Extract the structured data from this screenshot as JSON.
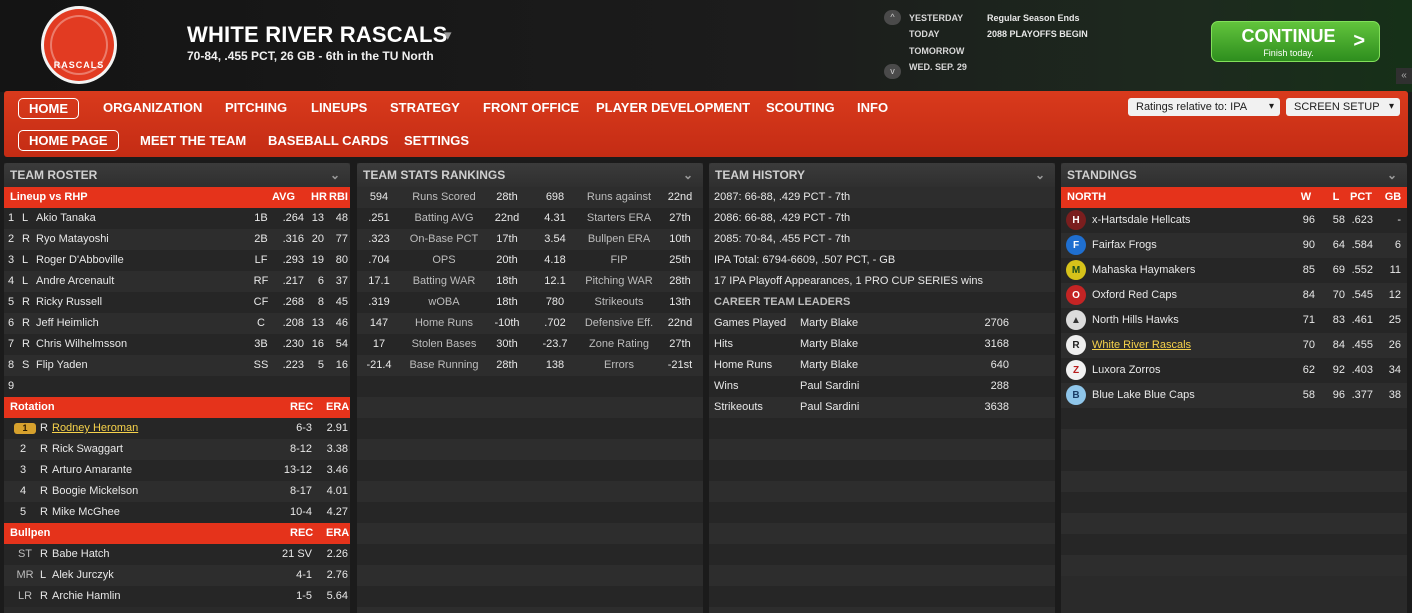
{
  "header": {
    "logo_text": "RASCALS",
    "team_name": "WHITE RIVER RASCALS",
    "record_line": "70-84, .455 PCT, 26 GB - 6th in the TU North",
    "dates": [
      "YESTERDAY",
      "TODAY",
      "TOMORROW",
      "WED. SEP. 29"
    ],
    "events": [
      "Regular Season Ends",
      "2088 PLAYOFFS BEGIN"
    ],
    "continue_label": "CONTINUE",
    "continue_sub": "Finish today.",
    "continue_arrow": ">",
    "up_arrow": "^",
    "down_arrow": "v",
    "collapse_glyph": "«"
  },
  "nav": {
    "top": [
      "HOME",
      "ORGANIZATION",
      "PITCHING",
      "LINEUPS",
      "STRATEGY",
      "FRONT OFFICE",
      "PLAYER DEVELOPMENT",
      "SCOUTING",
      "INFO"
    ],
    "sub": [
      "HOME PAGE",
      "MEET THE TEAM",
      "BASEBALL CARDS",
      "SETTINGS"
    ],
    "ratings_select": "Ratings relative to: IPA",
    "screen_setup": "SCREEN SETUP"
  },
  "roster": {
    "title": "TEAM ROSTER",
    "lineup_header": {
      "label": "Lineup vs RHP",
      "avg": "AVG",
      "hr": "HR",
      "rbi": "RBI"
    },
    "lineup": [
      {
        "n": "1",
        "hand": "L",
        "name": "Akio Tanaka",
        "pos": "1B",
        "avg": ".264",
        "hr": "13",
        "rbi": "48"
      },
      {
        "n": "2",
        "hand": "R",
        "name": "Ryo Matayoshi",
        "pos": "2B",
        "avg": ".316",
        "hr": "20",
        "rbi": "77"
      },
      {
        "n": "3",
        "hand": "L",
        "name": "Roger D'Abboville",
        "pos": "LF",
        "avg": ".293",
        "hr": "19",
        "rbi": "80"
      },
      {
        "n": "4",
        "hand": "L",
        "name": "Andre Arcenault",
        "pos": "RF",
        "avg": ".217",
        "hr": "6",
        "rbi": "37"
      },
      {
        "n": "5",
        "hand": "R",
        "name": "Ricky Russell",
        "pos": "CF",
        "avg": ".268",
        "hr": "8",
        "rbi": "45"
      },
      {
        "n": "6",
        "hand": "R",
        "name": "Jeff Heimlich",
        "pos": "C",
        "avg": ".208",
        "hr": "13",
        "rbi": "46"
      },
      {
        "n": "7",
        "hand": "R",
        "name": "Chris Wilhelmsson",
        "pos": "3B",
        "avg": ".230",
        "hr": "16",
        "rbi": "54"
      },
      {
        "n": "8",
        "hand": "S",
        "name": "Flip Yaden",
        "pos": "SS",
        "avg": ".223",
        "hr": "5",
        "rbi": "16"
      },
      {
        "n": "9",
        "hand": "",
        "name": "",
        "pos": "",
        "avg": "",
        "hr": "",
        "rbi": ""
      }
    ],
    "rotation_header": {
      "label": "Rotation",
      "rec": "REC",
      "era": "ERA"
    },
    "rotation": [
      {
        "n": "1",
        "hand": "R",
        "name": "Rodney Heroman",
        "rec": "6-3",
        "era": "2.91"
      },
      {
        "n": "2",
        "hand": "R",
        "name": "Rick Swaggart",
        "rec": "8-12",
        "era": "3.38"
      },
      {
        "n": "3",
        "hand": "R",
        "name": "Arturo Amarante",
        "rec": "13-12",
        "era": "3.46"
      },
      {
        "n": "4",
        "hand": "R",
        "name": "Boogie Mickelson",
        "rec": "8-17",
        "era": "4.01"
      },
      {
        "n": "5",
        "hand": "R",
        "name": "Mike McGhee",
        "rec": "10-4",
        "era": "4.27"
      }
    ],
    "bullpen_header": {
      "label": "Bullpen",
      "rec": "REC",
      "era": "ERA"
    },
    "bullpen": [
      {
        "role": "ST",
        "hand": "R",
        "name": "Babe Hatch",
        "rec": "21 SV",
        "era": "2.26"
      },
      {
        "role": "MR",
        "hand": "L",
        "name": "Alek Jurczyk",
        "rec": "4-1",
        "era": "2.76"
      },
      {
        "role": "LR",
        "hand": "R",
        "name": "Archie Hamlin",
        "rec": "1-5",
        "era": "5.64"
      }
    ]
  },
  "rankings": {
    "title": "TEAM STATS RANKINGS",
    "rows": [
      {
        "v1": "594",
        "l1": "Runs Scored",
        "r1": "28th",
        "v2": "698",
        "l2": "Runs against",
        "r2": "22nd"
      },
      {
        "v1": ".251",
        "l1": "Batting AVG",
        "r1": "22nd",
        "v2": "4.31",
        "l2": "Starters ERA",
        "r2": "27th"
      },
      {
        "v1": ".323",
        "l1": "On-Base PCT",
        "r1": "17th",
        "v2": "3.54",
        "l2": "Bullpen ERA",
        "r2": "10th"
      },
      {
        "v1": ".704",
        "l1": "OPS",
        "r1": "20th",
        "v2": "4.18",
        "l2": "FIP",
        "r2": "25th"
      },
      {
        "v1": "17.1",
        "l1": "Batting WAR",
        "r1": "18th",
        "v2": "12.1",
        "l2": "Pitching WAR",
        "r2": "28th"
      },
      {
        "v1": ".319",
        "l1": "wOBA",
        "r1": "18th",
        "v2": "780",
        "l2": "Strikeouts",
        "r2": "13th"
      },
      {
        "v1": "147",
        "l1": "Home Runs",
        "r1": "-10th",
        "v2": ".702",
        "l2": "Defensive Eff.",
        "r2": "22nd"
      },
      {
        "v1": "17",
        "l1": "Stolen Bases",
        "r1": "30th",
        "v2": "-23.7",
        "l2": "Zone Rating",
        "r2": "27th"
      },
      {
        "v1": "-21.4",
        "l1": "Base Running",
        "r1": "28th",
        "v2": "138",
        "l2": "Errors",
        "r2": "-21st"
      }
    ]
  },
  "history": {
    "title": "TEAM HISTORY",
    "lines": [
      "2087: 66-88, .429 PCT - 7th",
      "2086: 66-88, .429 PCT - 7th",
      "2085: 70-84, .455 PCT - 7th",
      "IPA Total: 6794-6609, .507 PCT, - GB",
      "17 IPA Playoff Appearances, 1 PRO CUP SERIES wins"
    ],
    "leaders_title": "CAREER TEAM LEADERS",
    "leaders": [
      {
        "cat": "Games Played",
        "name": "Marty Blake",
        "val": "2706"
      },
      {
        "cat": "Hits",
        "name": "Marty Blake",
        "val": "3168"
      },
      {
        "cat": "Home Runs",
        "name": "Marty Blake",
        "val": "640"
      },
      {
        "cat": "Wins",
        "name": "Paul Sardini",
        "val": "288"
      },
      {
        "cat": "Strikeouts",
        "name": "Paul Sardini",
        "val": "3638"
      }
    ]
  },
  "standings": {
    "title": "STANDINGS",
    "header": {
      "div": "NORTH",
      "w": "W",
      "l": "L",
      "pct": "PCT",
      "gb": "GB"
    },
    "teams": [
      {
        "name": "x-Hartsdale Hellcats",
        "w": "96",
        "l": "58",
        "pct": ".623",
        "gb": "-",
        "icon": "hellcats-logo-icon",
        "bg": "#7a1e1e",
        "fg": "#ffffff",
        "glyph": "H"
      },
      {
        "name": "Fairfax Frogs",
        "w": "90",
        "l": "64",
        "pct": ".584",
        "gb": "6",
        "icon": "frogs-logo-icon",
        "bg": "#1f6fd0",
        "fg": "#ffffff",
        "glyph": "F"
      },
      {
        "name": "Mahaska Haymakers",
        "w": "85",
        "l": "69",
        "pct": ".552",
        "gb": "11",
        "icon": "haymakers-logo-icon",
        "bg": "#d6c21a",
        "fg": "#1b4d1b",
        "glyph": "M"
      },
      {
        "name": "Oxford Red Caps",
        "w": "84",
        "l": "70",
        "pct": ".545",
        "gb": "12",
        "icon": "redcaps-logo-icon",
        "bg": "#c42424",
        "fg": "#ffffff",
        "glyph": "O"
      },
      {
        "name": "North Hills Hawks",
        "w": "71",
        "l": "83",
        "pct": ".461",
        "gb": "25",
        "icon": "hawks-logo-icon",
        "bg": "#dcdcdc",
        "fg": "#333333",
        "glyph": "▲"
      },
      {
        "name": "White River Rascals",
        "w": "70",
        "l": "84",
        "pct": ".455",
        "gb": "26",
        "icon": "rascals-logo-icon",
        "bg": "#eeeeee",
        "fg": "#222222",
        "glyph": "R"
      },
      {
        "name": "Luxora Zorros",
        "w": "62",
        "l": "92",
        "pct": ".403",
        "gb": "34",
        "icon": "zorros-logo-icon",
        "bg": "#f2f2f2",
        "fg": "#b81c1c",
        "glyph": "Z"
      },
      {
        "name": "Blue Lake Blue Caps",
        "w": "58",
        "l": "96",
        "pct": ".377",
        "gb": "38",
        "icon": "bluecaps-logo-icon",
        "bg": "#8fc6ea",
        "fg": "#1a3d66",
        "glyph": "B"
      }
    ]
  },
  "icons": {
    "chevron": "chevron-down-icon"
  },
  "colors": {
    "accent": "#e5331b",
    "continue": "#4fb22e",
    "link": "#f6d24b"
  }
}
